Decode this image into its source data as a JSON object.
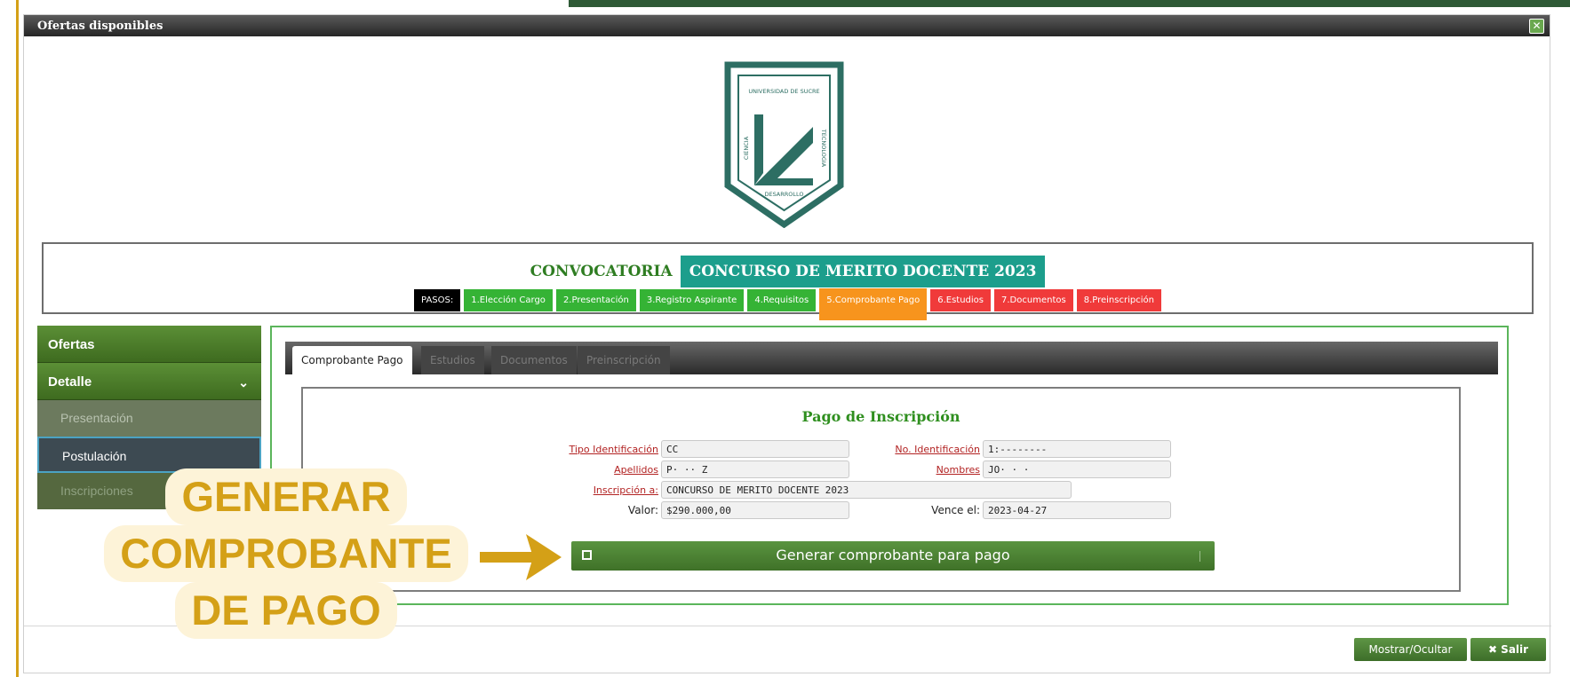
{
  "window": {
    "title": "Ofertas disponibles",
    "close_icon": "close-icon"
  },
  "logo": {
    "text_top": "UNIVERSIDAD DE SUCRE",
    "text_left": "CIENCIA",
    "text_right": "TECNOLOGIA",
    "text_bottom": "DESARROLLO",
    "color": "#2d6e63"
  },
  "convocatoria": {
    "label": "CONVOCATORIA",
    "value": "CONCURSO DE MERITO DOCENTE 2023",
    "steps": [
      {
        "label": "PASOS:",
        "style": "black"
      },
      {
        "label": "1.Elección Cargo",
        "style": "green"
      },
      {
        "label": "2.Presentación",
        "style": "green"
      },
      {
        "label": "3.Registro Aspirante",
        "style": "green"
      },
      {
        "label": "4.Requisitos",
        "style": "green"
      },
      {
        "label": "5.Comprobante Pago",
        "style": "orange"
      },
      {
        "label": "6.Estudios",
        "style": "red"
      },
      {
        "label": "7.Documentos",
        "style": "red"
      },
      {
        "label": "8.Preinscripción",
        "style": "red"
      }
    ]
  },
  "sidebar": {
    "ofertas": "Ofertas",
    "detalle": "Detalle",
    "chevron": "⌄",
    "items": [
      "Presentación",
      "Postulación",
      "Inscripciones"
    ]
  },
  "tabs": [
    "Comprobante Pago",
    "Estudios",
    "Documentos",
    "Preinscripción"
  ],
  "form": {
    "title": "Pago de Inscripción",
    "tipo_id_label": "Tipo Identificación",
    "tipo_id_value": "CC",
    "no_id_label": "No. Identificación",
    "no_id_value": "1:--------",
    "apellidos_label": "Apellidos",
    "apellidos_value": "P·            ·· Z",
    "nombres_label": "Nombres",
    "nombres_value": "JO·   ·     ·",
    "inscripcion_label": "Inscripción a:",
    "inscripcion_value": "CONCURSO DE MERITO DOCENTE 2023",
    "valor_label": "Valor:",
    "valor_value": "$290.000,00",
    "vence_label": "Vence el:",
    "vence_value": "2023-04-27",
    "generate_button": "Generar comprobante para pago"
  },
  "footer": {
    "mostrar": "Mostrar/Ocultar",
    "salir": "✖ Salir"
  },
  "callout": {
    "line1": "GENERAR",
    "line2": "COMPROBANTE",
    "line3": "DE PAGO",
    "color": "#d4a017"
  }
}
